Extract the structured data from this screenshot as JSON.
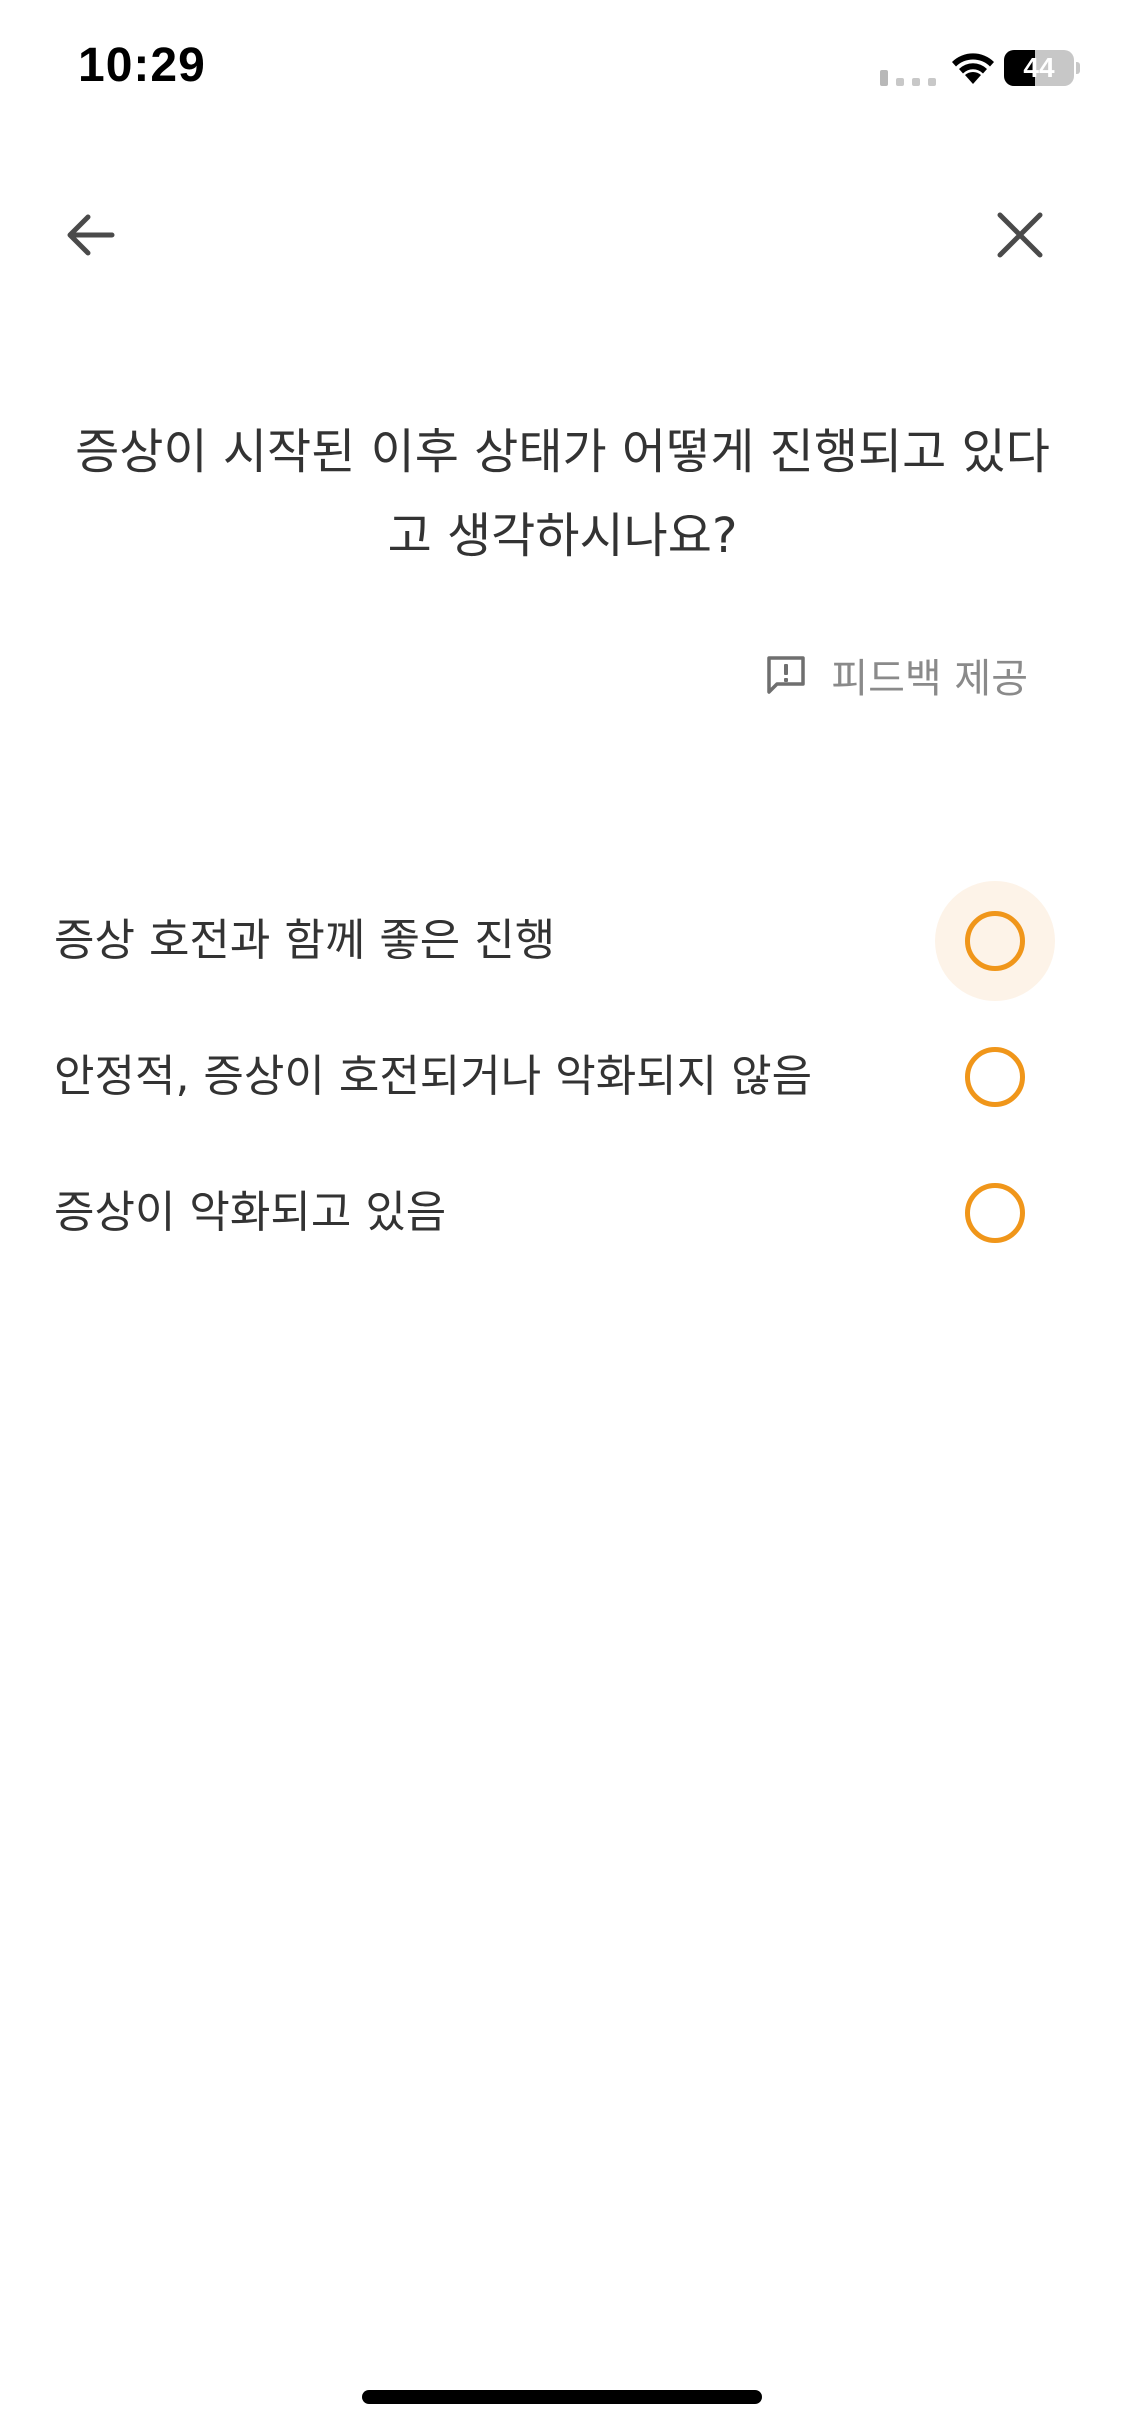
{
  "status_bar": {
    "time": "10:29",
    "battery_label": "44",
    "battery_level_percent": 44
  },
  "nav": {
    "back_icon": "arrow-left-icon",
    "close_icon": "close-icon"
  },
  "question": {
    "line1": "증상이 시작된 이후 상태가 어떻게 진행되고 있다",
    "line2": "고 생각하시나요?"
  },
  "feedback": {
    "icon": "feedback-message-icon",
    "label": "피드백 제공"
  },
  "options": [
    {
      "label": "증상 호전과 함께 좋은 진행",
      "selected": false,
      "focused": true
    },
    {
      "label": "안정적, 증상이 호전되거나 악화되지 않음",
      "selected": false,
      "focused": false
    },
    {
      "label": "증상이 악화되고 있음",
      "selected": false,
      "focused": false
    }
  ],
  "colors": {
    "accent": "#f0961a",
    "focus_halo": "#fdf3e8",
    "text_primary": "#333333",
    "text_secondary": "#8a8a8a",
    "icon": "#4a4a4a"
  }
}
